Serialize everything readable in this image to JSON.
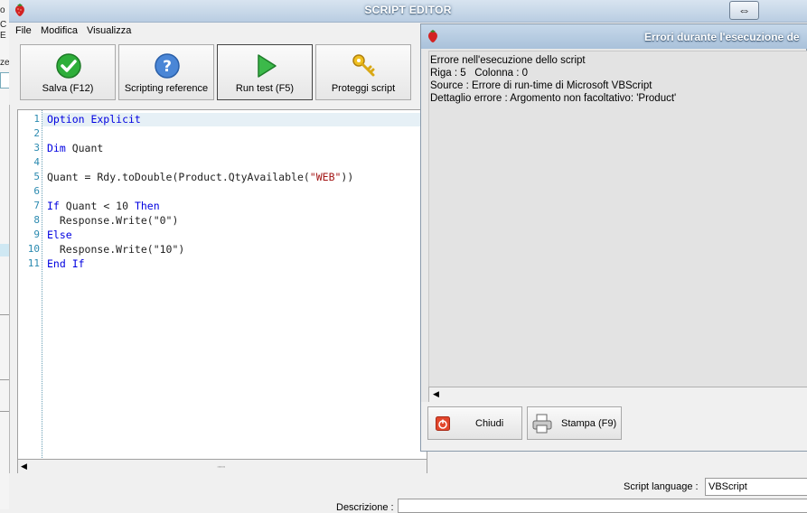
{
  "window": {
    "title": "SCRIPT EDITOR"
  },
  "menu": {
    "file": "File",
    "edit": "Modifica",
    "view": "Visualizza"
  },
  "toolbar": {
    "save_label": "Salva (F12)",
    "reference_label": "Scripting reference",
    "run_label": "Run test (F5)",
    "protect_label": "Proteggi script"
  },
  "editor": {
    "lines": [
      {
        "n": "1",
        "parts": [
          [
            "kw",
            "Option Explicit"
          ]
        ]
      },
      {
        "n": "2",
        "parts": []
      },
      {
        "n": "3",
        "parts": [
          [
            "kw",
            "Dim"
          ],
          [
            "t",
            " Quant"
          ]
        ]
      },
      {
        "n": "4",
        "parts": []
      },
      {
        "n": "5",
        "parts": [
          [
            "t",
            "Quant = Rdy.toDouble(Product.QtyAvailable("
          ],
          [
            "str",
            "\"WEB\""
          ],
          [
            "t",
            "))"
          ]
        ]
      },
      {
        "n": "6",
        "parts": []
      },
      {
        "n": "7",
        "parts": [
          [
            "kw",
            "If"
          ],
          [
            "t",
            " Quant < 10 "
          ],
          [
            "kw",
            "Then"
          ]
        ]
      },
      {
        "n": "8",
        "parts": [
          [
            "t",
            "  Response.Write(\"0\")"
          ]
        ]
      },
      {
        "n": "9",
        "parts": [
          [
            "kw",
            "Else"
          ]
        ]
      },
      {
        "n": "10",
        "parts": [
          [
            "t",
            "  Response.Write(\"10\")"
          ]
        ]
      },
      {
        "n": "11",
        "parts": [
          [
            "kw",
            "End If"
          ]
        ]
      }
    ]
  },
  "footer": {
    "language_label": "Script language :",
    "language_value": "VBScript",
    "description_label": "Descrizione :"
  },
  "error_dialog": {
    "title": "Errori durante l'esecuzione de",
    "lines": [
      "Errore nell'esecuzione dello script",
      "Riga : 5   Colonna : 0",
      "Source : Errore di run-time di Microsoft VBScript",
      "Dettaglio errore : Argomento non facoltativo: 'Product'"
    ],
    "close_label": "Chiudi",
    "print_label": "Stampa (F9)"
  },
  "background_app": {
    "fragments": [
      "o",
      "C",
      "E",
      "ze"
    ]
  },
  "colors": {
    "keyword": "#0000e0",
    "string": "#a31515",
    "line_number": "#2b8ab0",
    "titlebar": "#b9cde2"
  }
}
